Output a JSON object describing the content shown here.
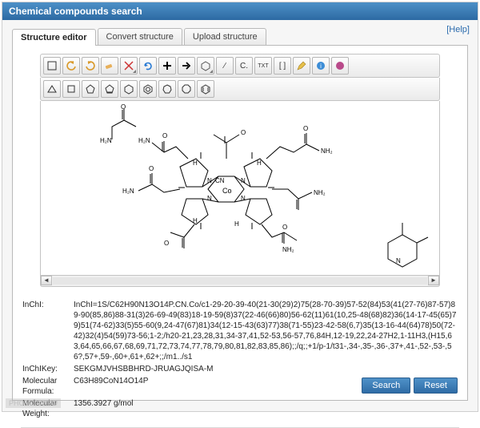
{
  "window": {
    "title": "Chemical compounds search"
  },
  "help": {
    "label": "[Help]"
  },
  "tabs": [
    {
      "label": "Structure editor",
      "active": true
    },
    {
      "label": "Convert structure",
      "active": false
    },
    {
      "label": "Upload structure",
      "active": false
    }
  ],
  "toolbar_row1": [
    {
      "name": "new-icon"
    },
    {
      "name": "undo-icon"
    },
    {
      "name": "redo-icon"
    },
    {
      "name": "erase-icon"
    },
    {
      "name": "cut-icon"
    },
    {
      "name": "refresh-icon"
    },
    {
      "name": "add-icon"
    },
    {
      "name": "next-icon"
    },
    {
      "name": "benzene-icon"
    },
    {
      "name": "bond-icon",
      "txt": "∕"
    },
    {
      "name": "carbon-icon",
      "txt": "C."
    },
    {
      "name": "text-icon",
      "txt": "TXT"
    },
    {
      "name": "brackets-icon",
      "txt": "[ ]"
    },
    {
      "name": "edit-icon"
    },
    {
      "name": "info-icon"
    },
    {
      "name": "logo-icon"
    }
  ],
  "toolbar_row2": [
    {
      "name": "triangle-icon"
    },
    {
      "name": "square-icon"
    },
    {
      "name": "pentagon-icon"
    },
    {
      "name": "cyclopentadiene-icon"
    },
    {
      "name": "hexagon-icon"
    },
    {
      "name": "benzene2-icon"
    },
    {
      "name": "heptagon-icon"
    },
    {
      "name": "octagon-icon"
    },
    {
      "name": "benzene3-icon"
    }
  ],
  "chem": {
    "inchi_label": "InChI:",
    "inchi_value": "InChI=1S/C62H90N13O14P.CN.Co/c1-29-20-39-40(21-30(29)2)75(28-70-39)57-52(84)53(41(27-76)87-57)89-90(85,86)88-31(3)26-69-49(83)18-19-59(8)37(22-46(66)80)56-62(11)61(10,25-48(68)82)36(14-17-45(65)79)51(74-62)33(5)55-60(9,24-47(67)81)34(12-15-43(63)77)38(71-55)23-42-58(6,7)35(13-16-44(64)78)50(72-42)32(4)54(59)73-56;1-2;/h20-21,23,28,31,34-37,41,52-53,56-57,76,84H,12-19,22,24-27H2,1-11H3,(H15,63,64,65,66,67,68,69,71,72,73,74,77,78,79,80,81,82,83,85,86);;/q;;+1/p-1/t31-,34-,35-,36-,37+,41-,52-,53-,56?,57+,59-,60+,61+,62+;;/m1../s1",
    "inchikey_label": "InChIKey:",
    "inchikey_value": "SEKGMJVHSBBHRD-JRUAGJQISA-M",
    "formula_label": "Molecular Formula:",
    "formula_value": "C63H89CoN14O14P",
    "weight_label": "Molecular Weight:",
    "weight_value": "1356.3927 g/mol"
  },
  "buttons": {
    "search": "Search",
    "reset": "Reset"
  },
  "watermark": "PHOTO: WIPO"
}
